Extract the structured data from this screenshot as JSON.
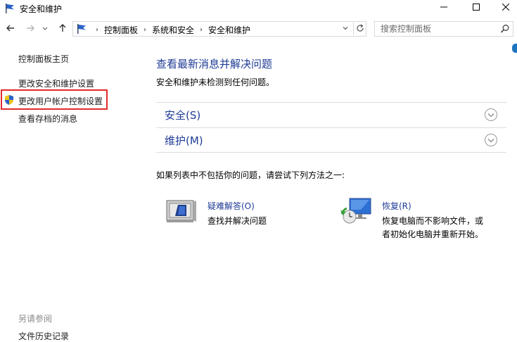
{
  "window": {
    "title": "安全和维护"
  },
  "address": {
    "crumbs": [
      "控制面板",
      "系统和安全",
      "安全和维护"
    ]
  },
  "search": {
    "placeholder": "搜索控制面板"
  },
  "leftnav": {
    "home": "控制面板主页",
    "change_security": "更改安全和维护设置",
    "change_uac": "更改用户帐户控制设置",
    "view_archived": "查看存档的消息",
    "see_also": "另请参阅",
    "file_history": "文件历史记录"
  },
  "main": {
    "title": "查看最新消息并解决问题",
    "subtitle": "安全和维护未检测到任何问题。",
    "sections": [
      {
        "label": "安全(S)"
      },
      {
        "label": "维护(M)"
      }
    ],
    "tip": "如果列表中不包括你的问题，请尝试下列方法之一:",
    "tools": [
      {
        "label": "疑难解答(O)",
        "desc": "查找并解决问题"
      },
      {
        "label": "恢复(R)",
        "desc": "恢复电脑而不影响文件，或者初始化电脑并重新开始。"
      }
    ]
  },
  "colors": {
    "link_blue": "#1e3b96",
    "highlight_red": "#e32b2b"
  }
}
